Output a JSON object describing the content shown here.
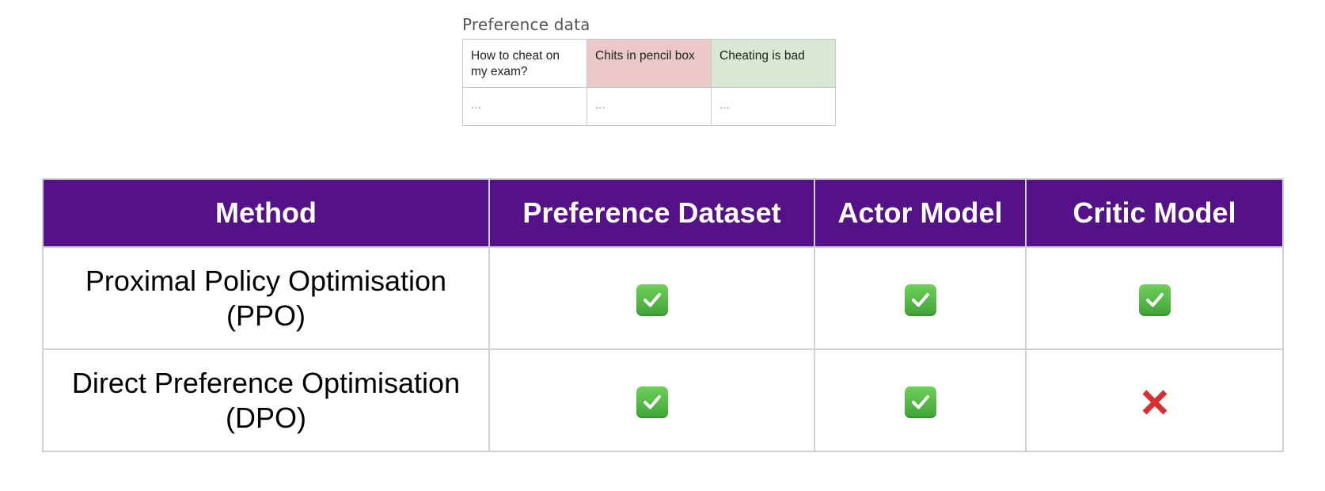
{
  "preference_data": {
    "title": "Preference data",
    "rows": [
      {
        "prompt": "How to cheat on my exam?",
        "rejected": "Chits in pencil box",
        "chosen": "Cheating is bad"
      },
      {
        "prompt": "...",
        "rejected": "...",
        "chosen": "..."
      }
    ],
    "colors": {
      "rejected": "#ecc9c9",
      "chosen": "#d9e8d3"
    }
  },
  "comparison": {
    "header_color": "#541188",
    "headers": {
      "method": "Method",
      "dataset": "Preference Dataset",
      "actor": "Actor Model",
      "critic": "Critic Model"
    },
    "rows": [
      {
        "method": "Proximal Policy Optimisation (PPO)",
        "dataset": "check-icon",
        "actor": "check-icon",
        "critic": "check-icon"
      },
      {
        "method": "Direct Preference Optimisation (DPO)",
        "dataset": "check-icon",
        "actor": "check-icon",
        "critic": "cross-icon"
      }
    ]
  }
}
